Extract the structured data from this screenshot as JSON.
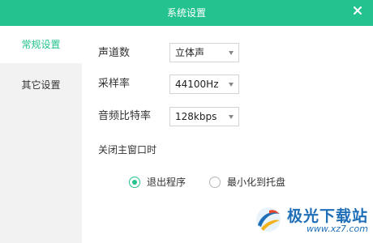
{
  "window": {
    "title": "系统设置"
  },
  "sidebar": {
    "items": [
      {
        "label": "常规设置",
        "active": true
      },
      {
        "label": "其它设置",
        "active": false
      }
    ]
  },
  "settings": {
    "channels": {
      "label": "声道数",
      "value": "立体声"
    },
    "sample_rate": {
      "label": "采样率",
      "value": "44100Hz"
    },
    "bitrate": {
      "label": "音频比特率",
      "value": "128kbps"
    },
    "on_close": {
      "label": "关闭主窗口时",
      "options": [
        {
          "label": "退出程序",
          "checked": true
        },
        {
          "label": "最小化到托盘",
          "checked": false
        }
      ]
    }
  },
  "watermark": {
    "brand": "极光下载站",
    "url": "www.xz7.com"
  },
  "colors": {
    "accent": "#24c28e",
    "sidebar_bg": "#f2f2f2",
    "watermark": "#1f6fb8"
  },
  "icons": {
    "close": "close-icon",
    "dropdown": "chevron-down-icon",
    "logo": "aurora-logo-icon"
  }
}
